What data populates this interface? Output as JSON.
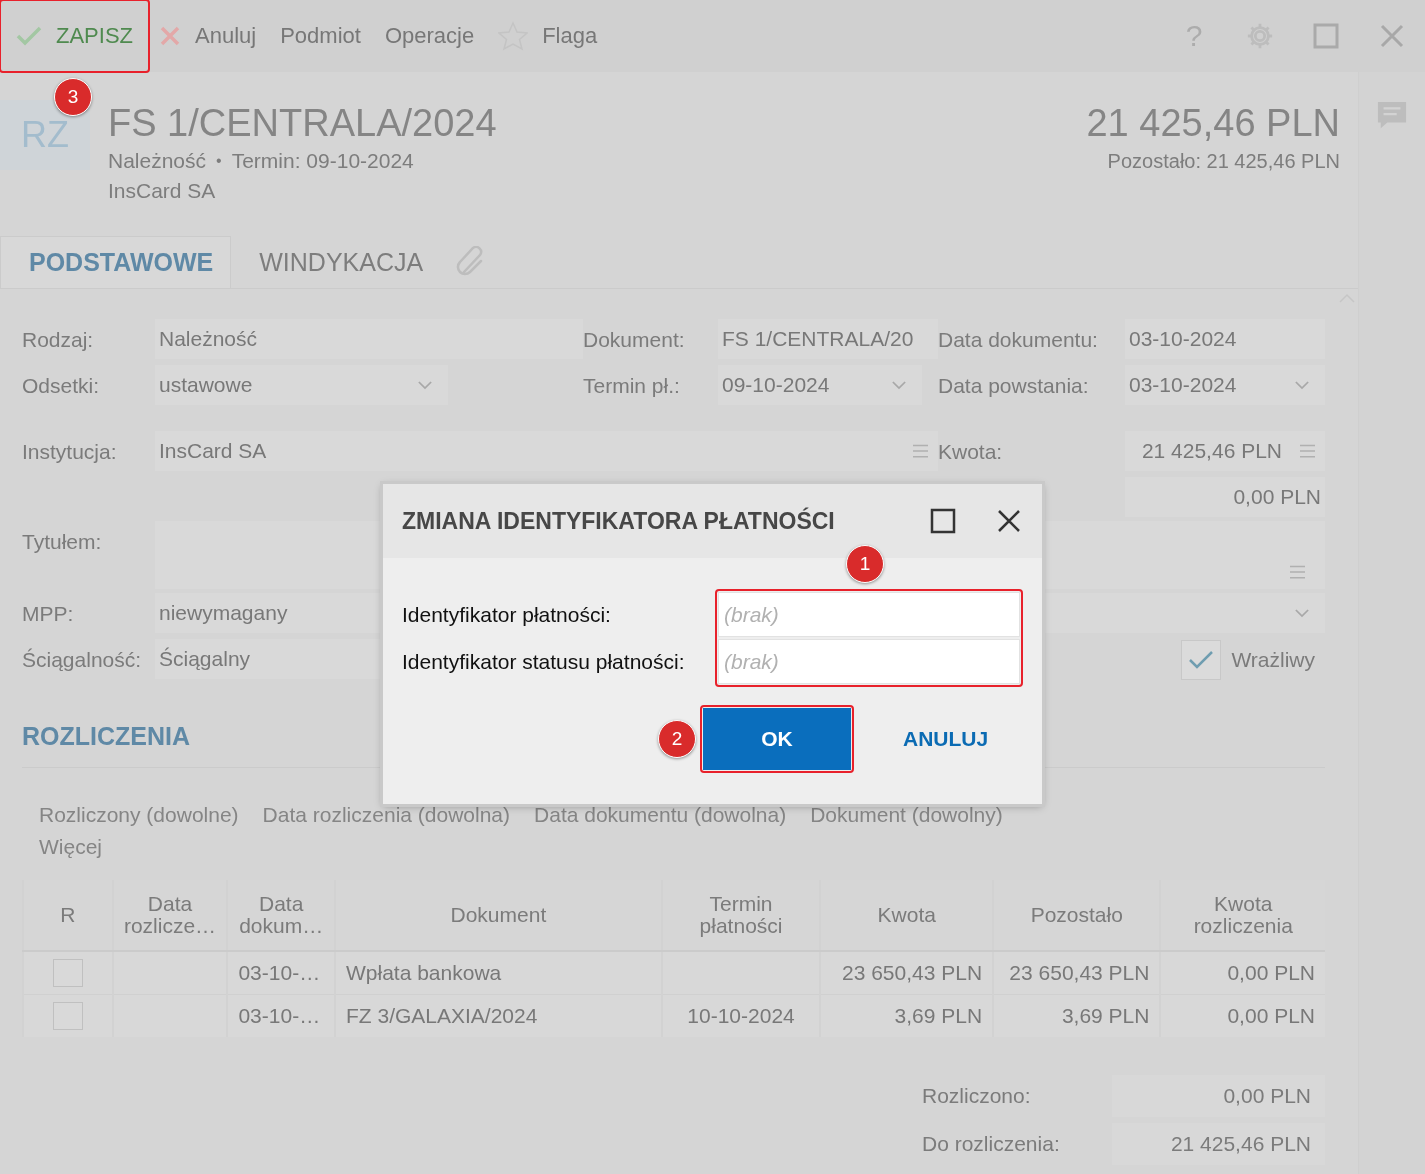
{
  "toolbar": {
    "items": [
      {
        "kind": "save",
        "label": "ZAPISZ",
        "highlighted": true,
        "callout": "3"
      },
      {
        "kind": "cancel",
        "label": "Anuluj",
        "highlighted": false
      },
      {
        "kind": "plain",
        "label": "Podmiot",
        "highlighted": false
      },
      {
        "kind": "plain",
        "label": "Operacje",
        "highlighted": false
      },
      {
        "kind": "flag",
        "label": "Flaga",
        "highlighted": false
      }
    ],
    "window_buttons": [
      {
        "kind": "help",
        "label": "?"
      },
      {
        "kind": "settings"
      },
      {
        "kind": "maximize"
      },
      {
        "kind": "close"
      }
    ]
  },
  "header": {
    "badge": "RZ",
    "title": "FS 1/CENTRALA/2024",
    "kind_label": "Należność",
    "separator": "•",
    "due": "Termin: 09-10-2024",
    "counterparty": "InsCard SA",
    "amount": "21 425,46 PLN",
    "remaining": "Pozostało: 21 425,46 PLN"
  },
  "tabs": [
    {
      "label": "PODSTAWOWE",
      "selected": true
    },
    {
      "label": "WINDYKACJA",
      "selected": false
    }
  ],
  "form": {
    "rows": [
      {
        "cells": [
          {
            "kind": "text",
            "label": "Rodzaj:",
            "value": "Należność"
          },
          {
            "kind": "text",
            "label": "Dokument:",
            "value": "FS 1/CENTRALA/20"
          },
          {
            "kind": "text",
            "label": "Data dokumentu:",
            "value": "03-10-2024"
          }
        ]
      },
      {
        "cells": [
          {
            "kind": "dropdown",
            "label": "Odsetki:",
            "value": "ustawowe"
          },
          {
            "kind": "dropdown",
            "label": "Termin pł.:",
            "value": "09-10-2024"
          },
          {
            "kind": "dropdown",
            "label": "Data powstania:",
            "value": "03-10-2024"
          }
        ]
      },
      {
        "cells": [
          {
            "kind": "lookup",
            "label": "Instytucja:",
            "value": "InsCard SA"
          },
          {
            "kind": "lookup",
            "label": "Kwota:",
            "value": "21 425,46 PLN"
          }
        ]
      },
      {
        "cells": [
          {
            "kind": "amount",
            "value": "0,00 PLN"
          }
        ]
      },
      {
        "cells": [
          {
            "kind": "memo",
            "label": "Tytułem:"
          }
        ]
      },
      {
        "cells": [
          {
            "kind": "dropdown",
            "label": "MPP:",
            "value": "niewymagany"
          }
        ]
      },
      {
        "cells": [
          {
            "kind": "text",
            "label": "Ściągalność:",
            "value": "Ściągalny"
          },
          {
            "kind": "checkbox",
            "label": "Wrażliwy",
            "checked": true
          }
        ]
      }
    ]
  },
  "settlements": {
    "title": "ROZLICZENIA",
    "filters": [
      "Rozliczony (dowolne)",
      "Data rozliczenia (dowolna)",
      "Data dokumentu (dowolna)",
      "Dokument (dowolny)"
    ],
    "more": "Więcej",
    "columns": [
      "R",
      "Data\nrozlicze…",
      "Data\ndokum…",
      "Dokument",
      "Termin\npłatności",
      "Kwota",
      "Pozostało",
      "Kwota\nrozliczenia"
    ],
    "rows": [
      {
        "settled": false,
        "document_date": "03-10-…",
        "document": "Wpłata bankowa",
        "amount": "23 650,43 PLN",
        "remaining": "23 650,43 PLN",
        "settle_amount": "0,00 PLN"
      },
      {
        "settled": false,
        "document_date": "03-10-…",
        "document": "FZ 3/GALAXIA/2024",
        "due": "10-10-2024",
        "amount": "3,69 PLN",
        "remaining": "3,69 PLN",
        "settle_amount": "0,00 PLN"
      }
    ],
    "summary": [
      {
        "label": "Rozliczono:",
        "value": "0,00 PLN"
      },
      {
        "label": "Do rozliczenia:",
        "value": "21 425,46 PLN"
      }
    ]
  },
  "dialog": {
    "title": "ZMIANA IDENTYFIKATORA PŁATNOŚCI",
    "fields": [
      {
        "label": "Identyfikator płatności:",
        "placeholder": "(brak)"
      },
      {
        "label": "Identyfikator statusu płatności:",
        "placeholder": "(brak)"
      }
    ],
    "fields_highlighted": true,
    "fields_callout": "1",
    "ok": {
      "label": "OK",
      "highlighted": true,
      "callout": "2"
    },
    "cancel": {
      "label": "ANULUJ"
    }
  }
}
